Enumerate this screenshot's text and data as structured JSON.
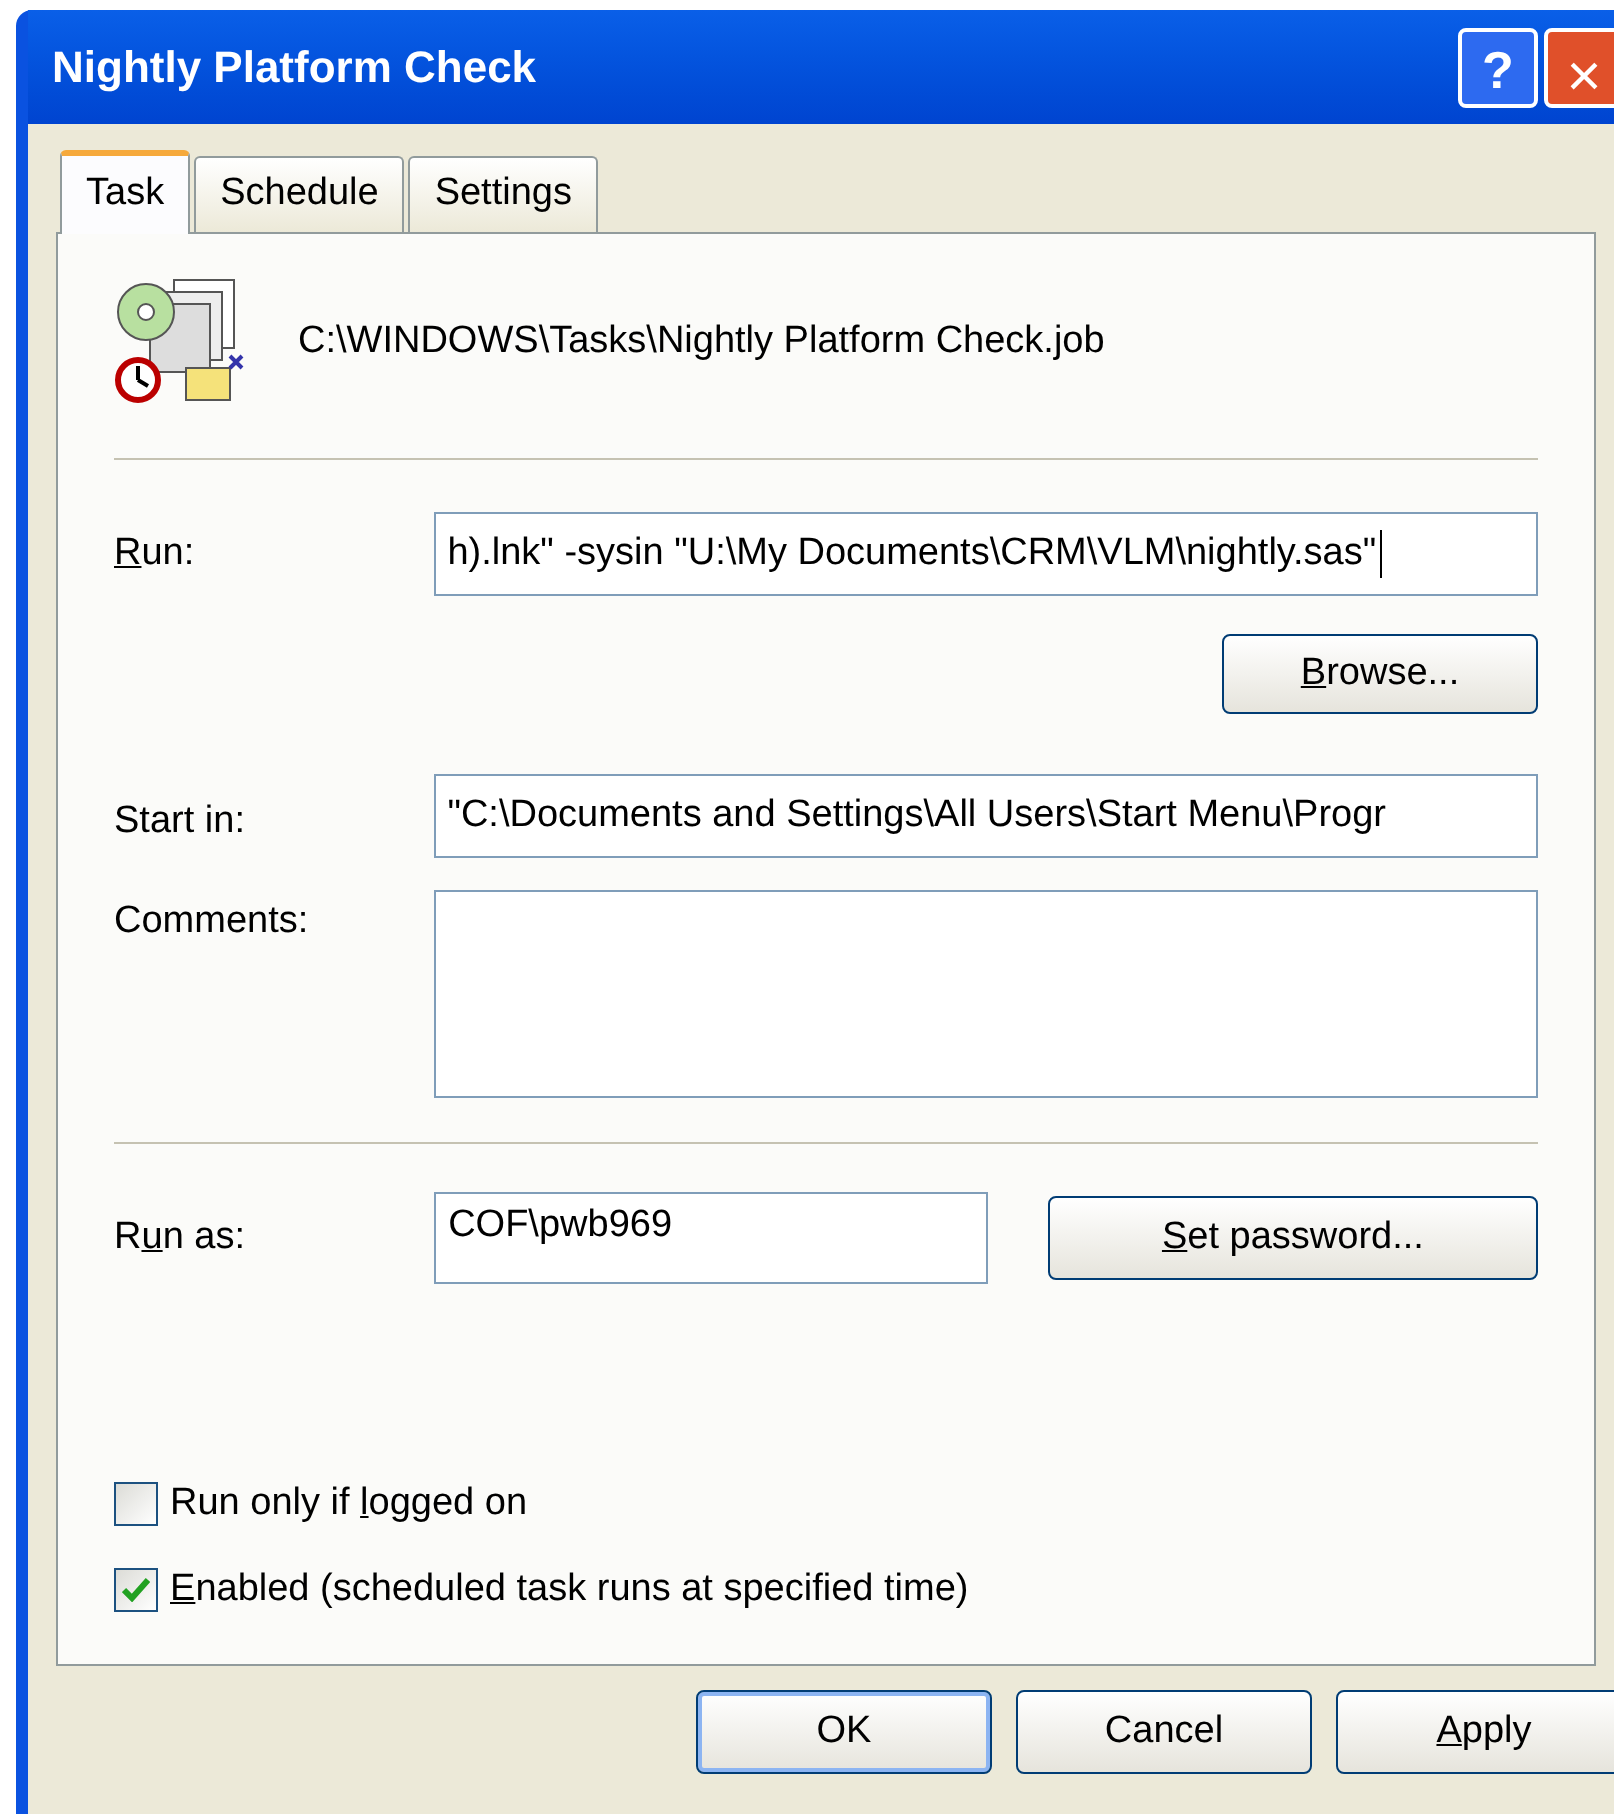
{
  "window": {
    "title": "Nightly Platform Check",
    "title_buttons": [
      "?",
      "×"
    ]
  },
  "tabs": [
    {
      "label": "Task",
      "selected": true
    },
    {
      "label": "Schedule",
      "selected": false
    },
    {
      "label": "Settings",
      "selected": false
    }
  ],
  "task_file": "C:\\WINDOWS\\Tasks\\Nightly Platform Check.job",
  "run": {
    "label": {
      "key": "R",
      "post": "un:"
    },
    "value": "h).lnk\" -sysin \"U:\\My Documents\\CRM\\VLM\\nightly.sas\""
  },
  "browse_button": {
    "key": "B",
    "post": "rowse..."
  },
  "start_in": {
    "label": "Start in:",
    "value": "\"C:\\Documents and Settings\\All Users\\Start Menu\\Progr"
  },
  "comments": {
    "label": "Comments:"
  },
  "run_as": {
    "label": {
      "pre": "R",
      "key": "u",
      "post": "n as:"
    },
    "value": "COF\\pwb969"
  },
  "set_password_button": {
    "key": "S",
    "post": "et password..."
  },
  "checkboxes": [
    {
      "label": {
        "pre": "Run only if ",
        "key": "l",
        "post": "ogged on"
      },
      "checked": false
    },
    {
      "label": {
        "key": "E",
        "post": "nabled (scheduled task runs at specified time)"
      },
      "checked": true
    }
  ],
  "buttons": [
    {
      "pre": "OK"
    },
    {
      "pre": "Cancel"
    },
    {
      "key": "A",
      "post": "pply"
    }
  ]
}
